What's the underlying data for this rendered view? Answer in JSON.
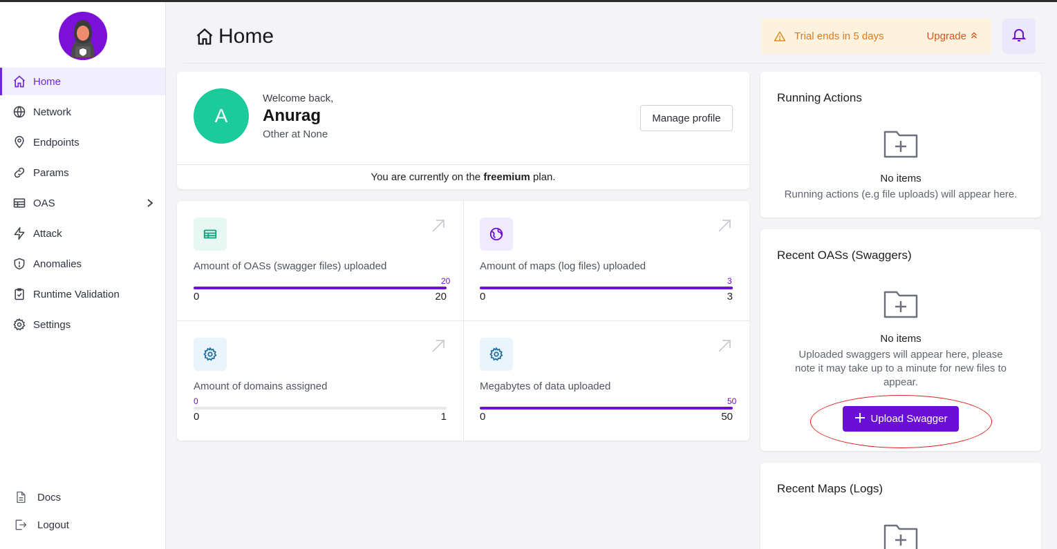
{
  "sidebar": {
    "items": [
      {
        "label": "Home",
        "icon": "home-icon",
        "active": true
      },
      {
        "label": "Network",
        "icon": "globe-icon"
      },
      {
        "label": "Endpoints",
        "icon": "map-pin-icon"
      },
      {
        "label": "Params",
        "icon": "link-icon"
      },
      {
        "label": "OAS",
        "icon": "table-icon"
      },
      {
        "label": "Attack",
        "icon": "bolt-icon"
      },
      {
        "label": "Anomalies",
        "icon": "shield-icon"
      },
      {
        "label": "Runtime Validation",
        "icon": "clipboard-check-icon"
      },
      {
        "label": "Settings",
        "icon": "gear-icon"
      }
    ],
    "bottom": [
      {
        "label": "Docs",
        "icon": "document-icon"
      },
      {
        "label": "Logout",
        "icon": "logout-icon"
      }
    ]
  },
  "header": {
    "title": "Home",
    "trial_text": "Trial ends in 5 days",
    "upgrade_label": "Upgrade"
  },
  "welcome": {
    "avatar_letter": "A",
    "greeting": "Welcome back,",
    "name": "Anurag",
    "role": "Other at None",
    "manage_label": "Manage profile",
    "plan_prefix": "You are currently on the",
    "plan_name": "freemium",
    "plan_suffix": "plan."
  },
  "stats": [
    {
      "label": "Amount of OASs (swagger files) uploaded",
      "value": 20,
      "min": "0",
      "max": "20",
      "value_label": "20",
      "icon": "table-icon",
      "icon_color": "#0f9f7a",
      "icon_bg": "#e6f8f1"
    },
    {
      "label": "Amount of maps (log files) uploaded",
      "value": 3,
      "min": "0",
      "max": "3",
      "value_label": "3",
      "icon": "globe-icon",
      "icon_color": "#6d0fd4",
      "icon_bg": "#efeafe"
    },
    {
      "label": "Amount of domains assigned",
      "value": 0,
      "min": "0",
      "max": "1",
      "value_label": "0",
      "icon": "gear-icon",
      "icon_color": "#1d6fa5",
      "icon_bg": "#e9f4fb"
    },
    {
      "label": "Megabytes of data uploaded",
      "value": 50,
      "min": "0",
      "max": "50",
      "value_label": "50",
      "icon": "gear-icon",
      "icon_color": "#1d6fa5",
      "icon_bg": "#e9f4fb"
    }
  ],
  "running_actions": {
    "title": "Running Actions",
    "empty_title": "No items",
    "empty_desc": "Running actions (e.g file uploads) will appear here."
  },
  "recent_oas": {
    "title": "Recent OASs (Swaggers)",
    "empty_title": "No items",
    "empty_desc": "Uploaded swaggers will appear here, please note it may take up to a minute for new files to appear.",
    "button_label": "Upload Swagger"
  },
  "recent_maps": {
    "title": "Recent Maps (Logs)"
  },
  "colors": {
    "accent": "#6d0fd4",
    "trial_bg": "#fdf2dd",
    "avatar": "#1ccb9b"
  }
}
